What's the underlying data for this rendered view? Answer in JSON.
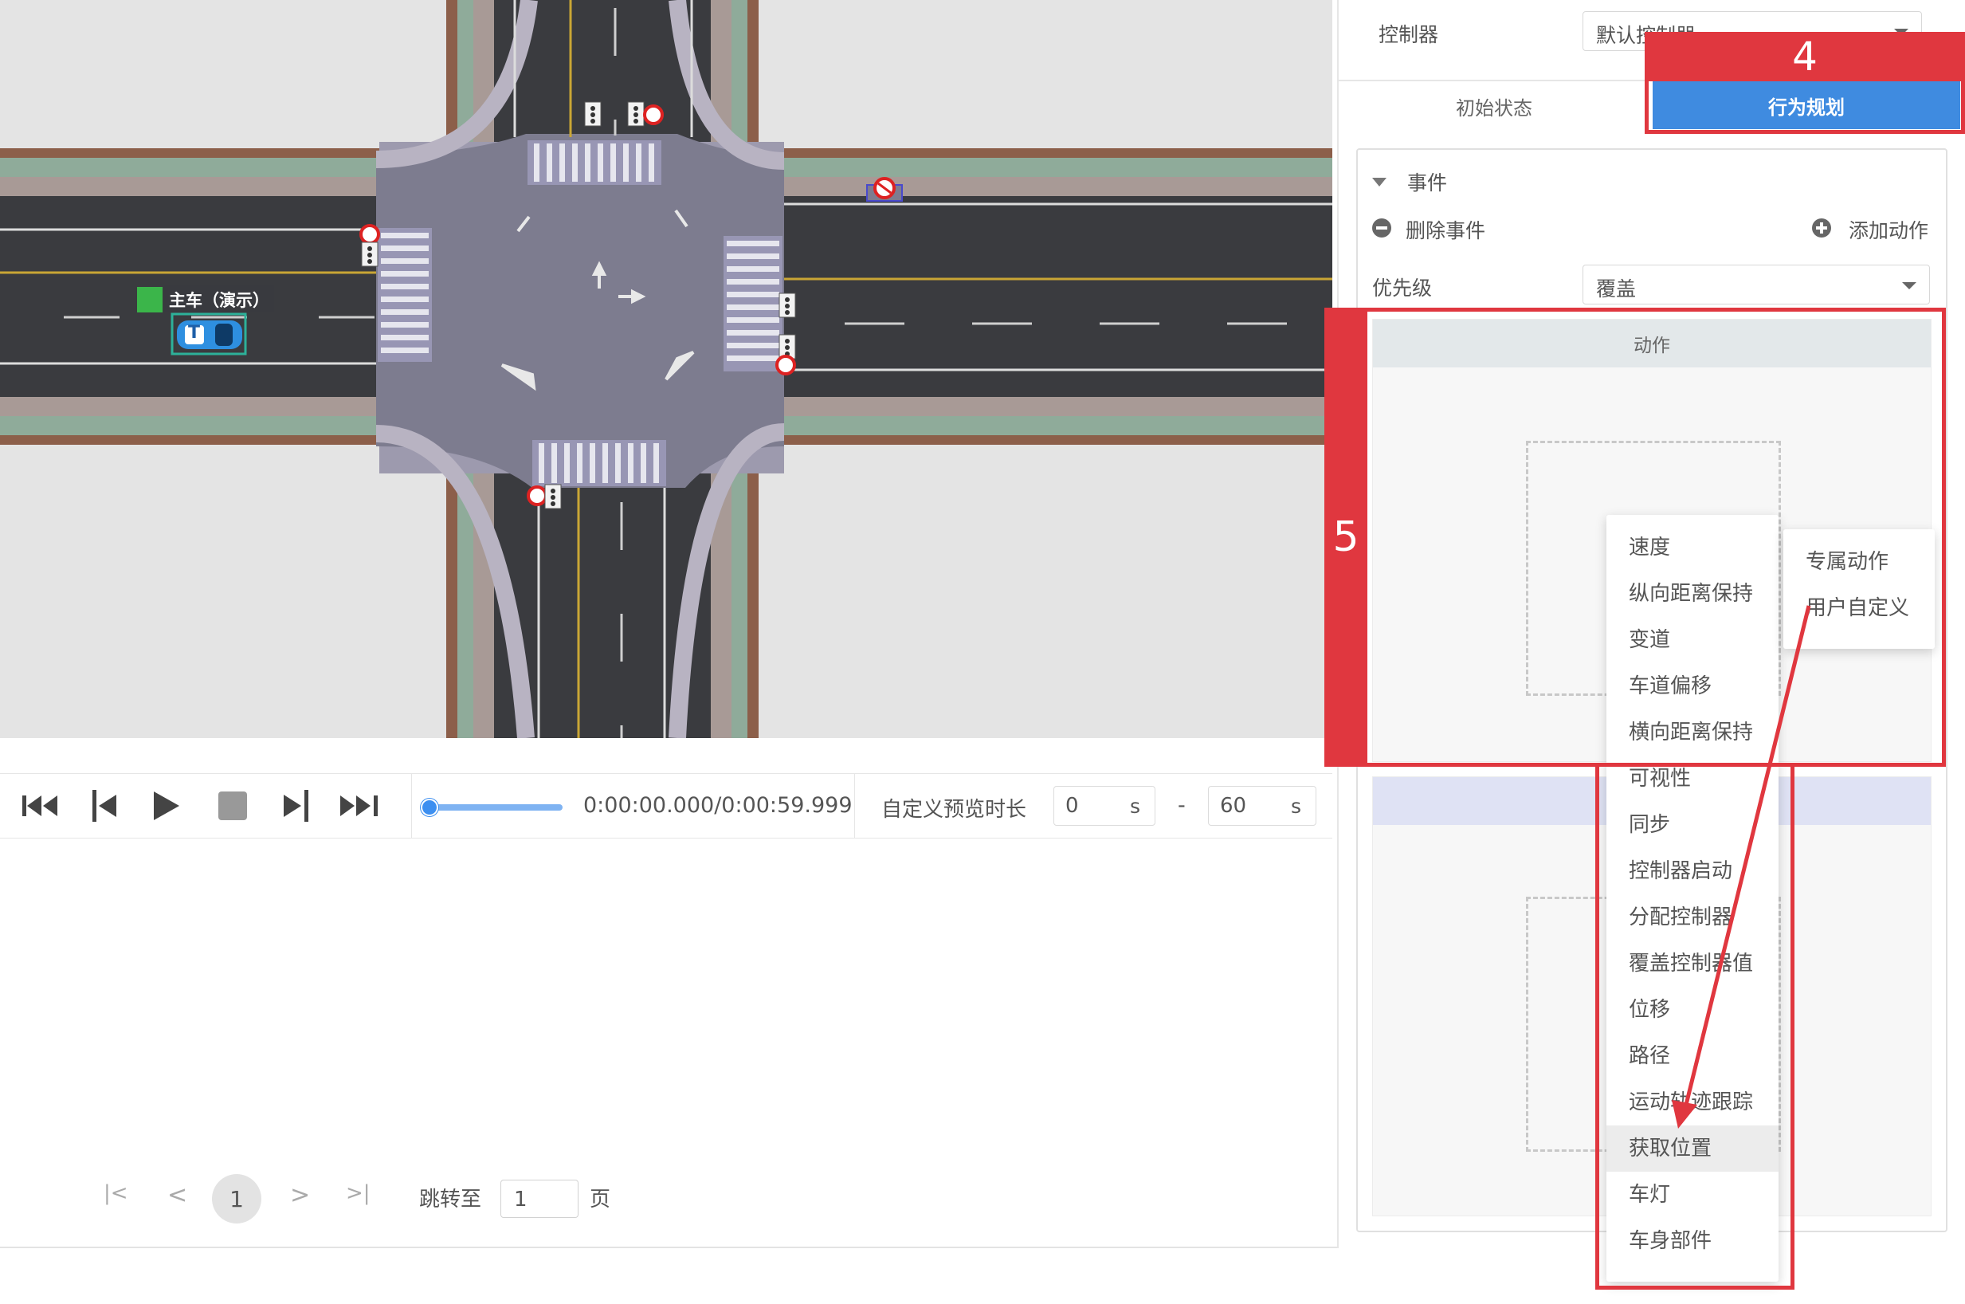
{
  "map": {
    "vehicle_label": "主车（演示）",
    "vehicle_marker": "T"
  },
  "player": {
    "icons": [
      "skip-to-start-icon",
      "step-back-icon",
      "play-icon",
      "stop-icon",
      "step-forward-icon",
      "skip-to-end-icon"
    ],
    "time": "0:00:00.000/0:00:59.999",
    "progress": 0,
    "custom_duration_label": "自定义预览时长",
    "start_value": "0",
    "end_value": "60",
    "unit": "s",
    "separator": "-"
  },
  "pagination": {
    "first": "|<",
    "prev": "<",
    "current": "1",
    "next": ">",
    "last": ">|",
    "jump_label": "跳转至",
    "jump_value": "1",
    "page_suffix": "页"
  },
  "panel": {
    "controller_label": "控制器",
    "controller_value": "默认控制器",
    "tabs": {
      "initial": "初始状态",
      "behavior": "行为规划"
    },
    "event_title": "事件",
    "delete_event": "删除事件",
    "add_action": "添加动作",
    "priority_label": "优先级",
    "priority_value": "覆盖",
    "action_header": "动作"
  },
  "menu": {
    "items": [
      "速度",
      "纵向距离保持",
      "变道",
      "车道偏移",
      "横向距离保持",
      "可视性",
      "同步",
      "控制器启动",
      "分配控制器",
      "覆盖控制器值",
      "位移",
      "路径",
      "运动轨迹跟踪",
      "获取位置",
      "车灯",
      "车身部件"
    ],
    "active_item": "获取位置",
    "sub_items": [
      "专属动作",
      "用户自定义"
    ]
  },
  "annotations": {
    "step4": "4",
    "step5": "5",
    "color": "#e0373f"
  },
  "colors": {
    "accent": "#3f8be0",
    "road": "#3a3b3f",
    "intersection": "#7d7c8f",
    "sidewalk": "#a89a96",
    "curb_green": "#8fab9a",
    "border_brown": "#8c5f4a"
  }
}
